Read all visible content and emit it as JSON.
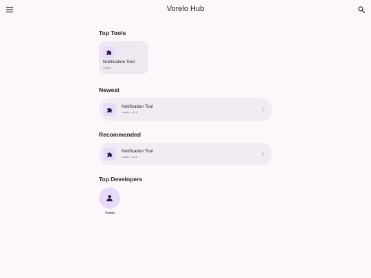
{
  "header": {
    "title": "Vorelo Hub",
    "menu_icon": "menu-icon",
    "search_icon": "search-icon"
  },
  "sections": {
    "top_tools": {
      "title": "Top Tools",
      "items": [
        {
          "name": "Notification Tool",
          "developer": "Vorelo",
          "icon": "puzzle-icon"
        }
      ]
    },
    "newest": {
      "title": "Newest",
      "items": [
        {
          "name": "Notification Tool",
          "subtitle": "Vorelo • v2.4",
          "icon": "puzzle-icon"
        }
      ]
    },
    "recommended": {
      "title": "Recommended",
      "items": [
        {
          "name": "Notification Tool",
          "subtitle": "Vorelo • v2.4",
          "icon": "puzzle-icon"
        }
      ]
    },
    "top_developers": {
      "title": "Top Developers",
      "items": [
        {
          "name": "Vorelo",
          "icon": "person-icon"
        }
      ]
    }
  },
  "colors": {
    "background": "#fdf7fb",
    "card": "#efe8f0",
    "row": "#f1ecf3",
    "icon_tile": "#e8ddf9",
    "icon_glyph": "#2a1a4a"
  }
}
